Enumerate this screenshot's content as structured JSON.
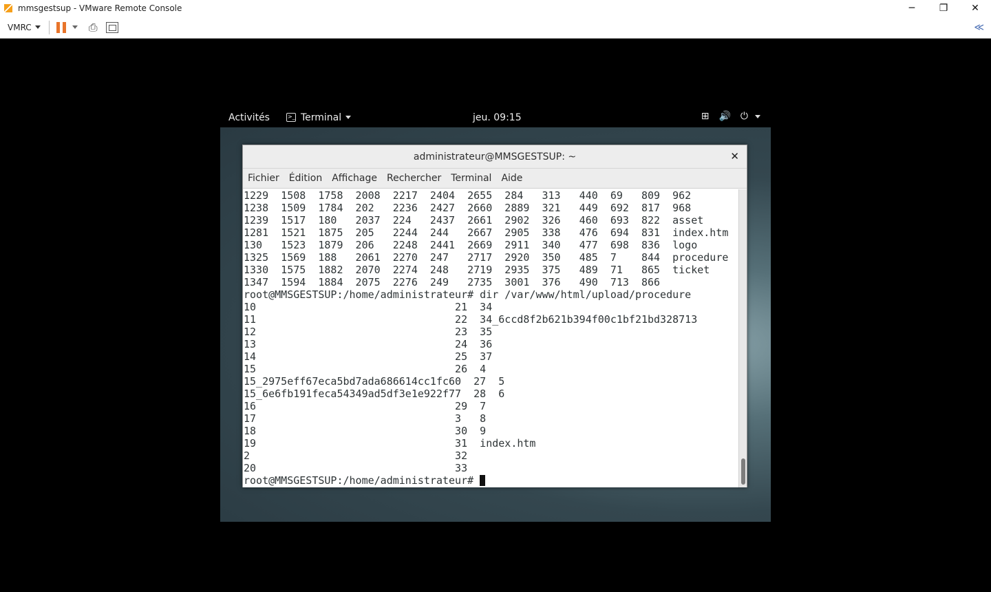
{
  "host": {
    "title": "mmsgestsup - VMware Remote Console",
    "minimize": "─",
    "restore": "❐",
    "close": "✕"
  },
  "toolbar": {
    "vmrc_label": "VMRC",
    "send_keys_icon": "⎙",
    "collapse_icon": "≪"
  },
  "gnome": {
    "activities": "Activités",
    "app_menu": "Terminal",
    "clock": "jeu. 09:15",
    "network_icon": "⊞",
    "volume_icon": "🔊",
    "power_icon": "⏻"
  },
  "terminal": {
    "title": "administrateur@MMSGESTSUP: ~",
    "close": "✕",
    "menu": [
      "Fichier",
      "Édition",
      "Affichage",
      "Rechercher",
      "Terminal",
      "Aide"
    ],
    "lines": [
      "1229  1508  1758  2008  2217  2404  2655  284   313   440  69   809  962",
      "1238  1509  1784  202   2236  2427  2660  2889  321   449  692  817  968",
      "1239  1517  180   2037  224   2437  2661  2902  326   460  693  822  asset",
      "1281  1521  1875  205   2244  244   2667  2905  338   476  694  831  index.htm",
      "130   1523  1879  206   2248  2441  2669  2911  340   477  698  836  logo",
      "1325  1569  188   2061  2270  247   2717  2920  350   485  7    844  procedure",
      "1330  1575  1882  2070  2274  248   2719  2935  375   489  71   865  ticket",
      "1347  1594  1884  2075  2276  249   2735  3001  376   490  713  866",
      "root@MMSGESTSUP:/home/administrateur# dir /var/www/html/upload/procedure",
      "10                                21  34",
      "11                                22  34_6ccd8f2b621b394f00c1bf21bd328713",
      "12                                23  35",
      "13                                24  36",
      "14                                25  37",
      "15                                26  4",
      "15_2975eff67eca5bd7ada686614cc1fc60  27  5",
      "15_6e6fb191feca54349ad5df3e1e922f77  28  6",
      "16                                29  7",
      "17                                3   8",
      "18                                30  9",
      "19                                31  index.htm",
      "2                                 32",
      "20                                33"
    ],
    "prompt": "root@MMSGESTSUP:/home/administrateur# "
  },
  "colors": {
    "pause_accent": "#e8742a",
    "terminal_text": "#2e3436"
  }
}
